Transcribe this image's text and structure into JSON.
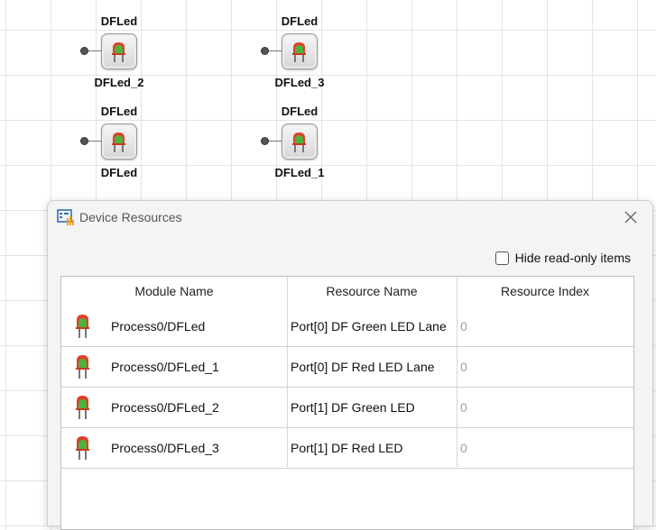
{
  "canvas": {
    "blocks": [
      {
        "top_label": "DFLed",
        "bottom_label": "DFLed_2"
      },
      {
        "top_label": "DFLed",
        "bottom_label": "DFLed_3"
      },
      {
        "top_label": "DFLed",
        "bottom_label": "DFLed"
      },
      {
        "top_label": "DFLed",
        "bottom_label": "DFLed_1"
      }
    ]
  },
  "dialog": {
    "title": "Device Resources",
    "hide_readonly_label": "Hide read-only items",
    "hide_readonly_checked": false,
    "columns": [
      "Module Name",
      "Resource Name",
      "Resource Index"
    ],
    "rows": [
      {
        "module": "Process0/DFLed",
        "resource": "Port[0] DF Green LED Lane",
        "index": "0",
        "icon": "led-icon"
      },
      {
        "module": "Process0/DFLed_1",
        "resource": "Port[0] DF Red LED Lane",
        "index": "0",
        "icon": "led-icon"
      },
      {
        "module": "Process0/DFLed_2",
        "resource": "Port[1] DF Green LED",
        "index": "0",
        "icon": "led-icon"
      },
      {
        "module": "Process0/DFLed_3",
        "resource": "Port[1] DF Red LED",
        "index": "0",
        "icon": "led-icon"
      }
    ]
  },
  "colors": {
    "led_red": "#e0402a",
    "led_green": "#3fbf3f",
    "grid": "#e4e4e4"
  }
}
